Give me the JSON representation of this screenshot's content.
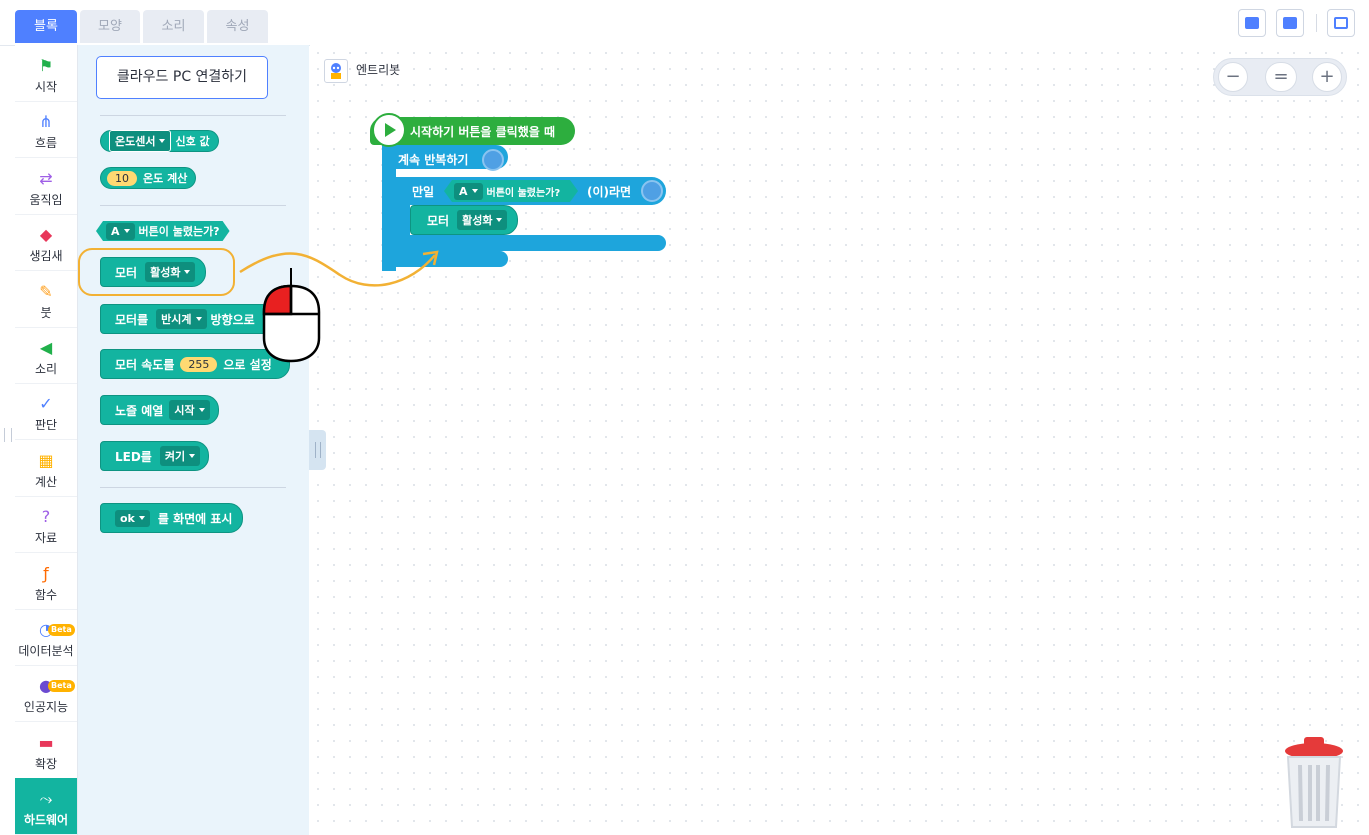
{
  "tabs": [
    "블록",
    "모양",
    "소리",
    "속성"
  ],
  "categories": [
    {
      "label": "시작",
      "icon": "flag-icon",
      "color": "#21b04b"
    },
    {
      "label": "흐름",
      "icon": "flow-icon",
      "color": "#4f80ff"
    },
    {
      "label": "움직임",
      "icon": "move-icon",
      "color": "#9f5fe6"
    },
    {
      "label": "생김새",
      "icon": "looks-icon",
      "color": "#e8375a"
    },
    {
      "label": "붓",
      "icon": "brush-icon",
      "color": "#ff9f1c"
    },
    {
      "label": "소리",
      "icon": "sound-icon",
      "color": "#21b04b"
    },
    {
      "label": "판단",
      "icon": "judgement-icon",
      "color": "#4f80ff"
    },
    {
      "label": "계산",
      "icon": "calc-icon",
      "color": "#ffb200"
    },
    {
      "label": "자료",
      "icon": "data-icon",
      "color": "#9f5fe6"
    },
    {
      "label": "함수",
      "icon": "function-icon",
      "color": "#ff6a00"
    },
    {
      "label": "데이터분석",
      "icon": "chart-icon",
      "color": "#4f80ff",
      "badge": "Beta"
    },
    {
      "label": "인공지능",
      "icon": "ai-icon",
      "color": "#6b4ad1",
      "badge": "Beta"
    },
    {
      "label": "확장",
      "icon": "extension-icon",
      "color": "#e8375a"
    },
    {
      "label": "하드웨어",
      "icon": "hardware-icon",
      "color": "#ffffff"
    }
  ],
  "palette": {
    "cloud_button": "클라우드 PC 연결하기",
    "sensor_dd": "온도센서",
    "sensor_suffix": "신호 값",
    "temp_num": "10",
    "temp_suffix": "온도 계산",
    "button_dd": "A",
    "button_suffix": "버튼이 눌렸는가?",
    "motor_prefix": "모터",
    "motor_dd": "활성화",
    "motor_dir_prefix": "모터를",
    "motor_dir_dd": "반시계",
    "motor_dir_suffix": "방향으로",
    "motor_speed_prefix": "모터 속도를",
    "motor_speed_num": "255",
    "motor_speed_suffix": "으로 설정",
    "melody_prefix": "노즐 예열",
    "melody_dd": "시작",
    "led_prefix": "LED를",
    "led_dd": "켜기",
    "ok_dd": "ok",
    "ok_suffix": "를 화면에 표시"
  },
  "canvas": {
    "object_name": "엔트리봇",
    "start_label": "시작하기 버튼을 클릭했을 때",
    "loop_label": "계속 반복하기",
    "if_prefix": "만일",
    "if_dd": "A",
    "if_cond": "버튼이 눌렸는가?",
    "if_suffix": "(이)라면",
    "inner_prefix": "모터",
    "inner_dd": "활성화",
    "zoom_out": "−",
    "zoom_reset": "=",
    "zoom_in": "+"
  }
}
